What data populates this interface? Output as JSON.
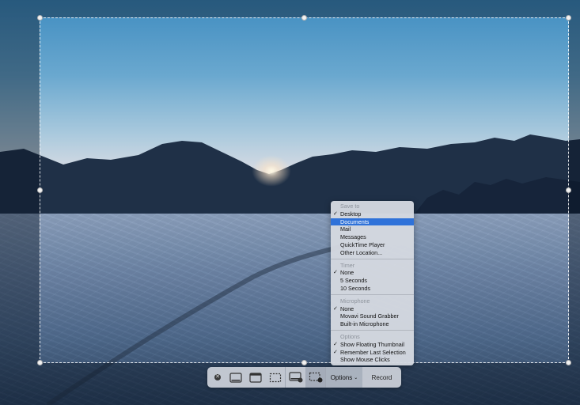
{
  "toolbar": {
    "options_label": "Options",
    "record_label": "Record",
    "buttons": [
      "close-icon",
      "capture-entire-screen-icon",
      "capture-window-icon",
      "capture-selection-icon",
      "record-entire-screen-icon",
      "record-selection-icon"
    ]
  },
  "menu": {
    "save_to": {
      "header": "Save to",
      "items": [
        "Desktop",
        "Documents",
        "Mail",
        "Messages",
        "QuickTime Player",
        "Other Location..."
      ],
      "checked": "Desktop",
      "highlighted": "Documents"
    },
    "timer": {
      "header": "Timer",
      "items": [
        "None",
        "5 Seconds",
        "10 Seconds"
      ],
      "checked": "None"
    },
    "microphone": {
      "header": "Microphone",
      "items": [
        "None",
        "Movavi Sound Grabber",
        "Built-in Microphone"
      ],
      "checked": "None"
    },
    "options": {
      "header": "Options",
      "items": [
        "Show Floating Thumbnail",
        "Remember Last Selection",
        "Show Mouse Clicks"
      ],
      "checked": [
        "Show Floating Thumbnail",
        "Remember Last Selection"
      ]
    }
  },
  "colors": {
    "highlight": "#2f72d9",
    "menu_bg": "#d4d8e0",
    "toolbar_bg": "#cdd2da"
  }
}
